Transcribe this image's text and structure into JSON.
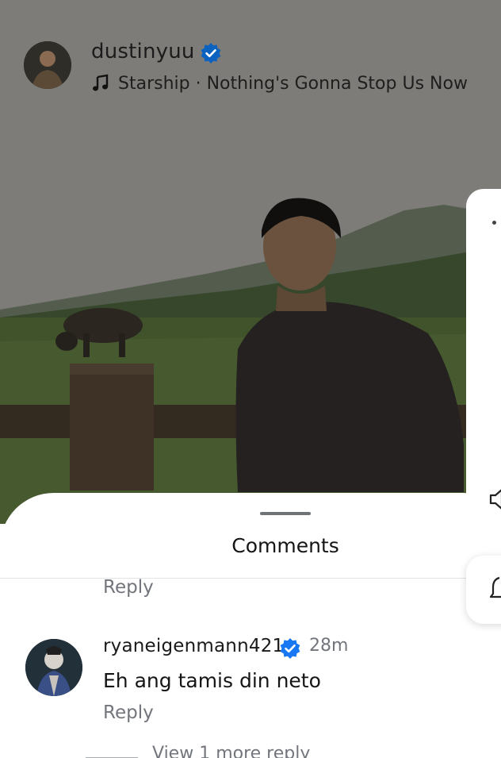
{
  "post": {
    "author": "dustinyuu",
    "music": "Starship · Nothing's Gonna Stop Us Now"
  },
  "comments_sheet": {
    "title": "Comments",
    "previous_reply_label": "Reply",
    "comments": [
      {
        "username": "ryaneigenmann421",
        "time": "28m",
        "text": "Eh ang tamis din neto",
        "reply_label": "Reply",
        "more_replies": "View 1 more reply"
      }
    ]
  },
  "icons": {
    "verified": "verified-badge-icon",
    "music": "music-note-icon",
    "speaker": "speaker-icon",
    "notification": "bell-icon"
  },
  "colors": {
    "verified_blue": "#1877f2",
    "secondary_text": "#72767c",
    "primary_text": "#151515"
  }
}
